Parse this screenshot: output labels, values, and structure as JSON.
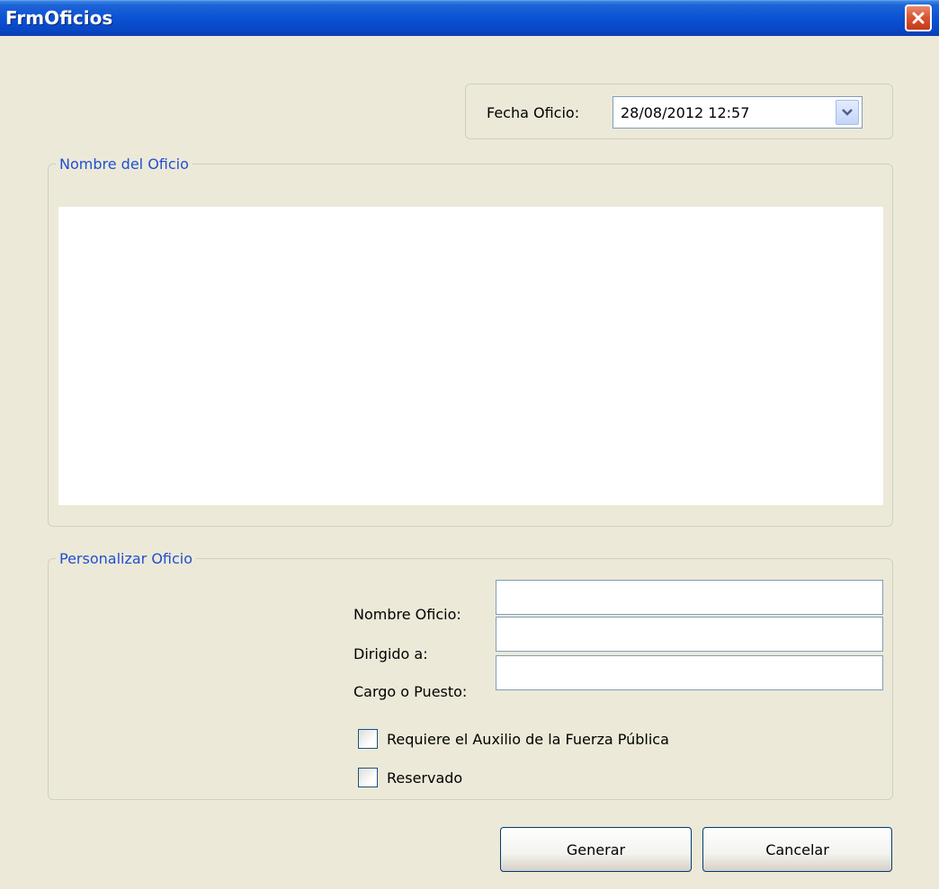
{
  "window": {
    "title": "FrmOficios"
  },
  "fecha": {
    "label": "Fecha Oficio:",
    "value": "28/08/2012 12:57"
  },
  "nombre_group": {
    "legend": "Nombre del Oficio"
  },
  "personalizar_group": {
    "legend": "Personalizar Oficio",
    "fields": [
      {
        "label": "Nombre Oficio:",
        "value": ""
      },
      {
        "label": "Dirigido a:",
        "value": ""
      },
      {
        "label": "Cargo o Puesto:",
        "value": ""
      }
    ],
    "checkboxes": [
      {
        "label": "Requiere el Auxilio de la Fuerza Pública",
        "checked": false
      },
      {
        "label": "Reservado",
        "checked": false
      }
    ]
  },
  "buttons": {
    "generate": "Generar",
    "cancel": "Cancelar"
  },
  "colors": {
    "titlebar": "#0a52d4",
    "legend": "#1f4fd1",
    "background": "#ece9d8",
    "close": "#d9522f"
  },
  "icons": {
    "close": "close-icon",
    "dropdown": "chevron-down-icon"
  }
}
